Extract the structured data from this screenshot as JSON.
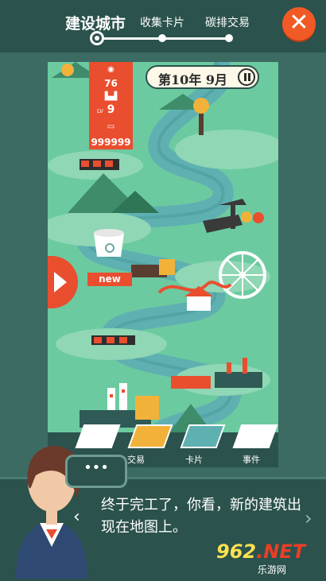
{
  "header": {
    "tabs": [
      {
        "label": "建设城市",
        "active": true
      },
      {
        "label": "收集卡片",
        "active": false
      },
      {
        "label": "碳排交易",
        "active": false
      }
    ],
    "close_icon": "close-icon"
  },
  "stats": {
    "satisfaction": "76",
    "level_label": "LV",
    "level": "9",
    "money": "999999"
  },
  "date": {
    "label": "第10年 9月"
  },
  "map": {
    "new_badge": "new"
  },
  "bottom_menu": {
    "items": [
      {
        "label": "交易"
      },
      {
        "label": "卡片"
      },
      {
        "label": "事件"
      }
    ]
  },
  "dialog": {
    "text": "终于完工了，你看，新的建筑出现在地图上。",
    "bubble": "•••"
  },
  "watermark": {
    "main_prefix": "962",
    "main_suffix": ".NET",
    "sub": "乐游网"
  },
  "colors": {
    "accent": "#e94e2f",
    "panel": "#2b524c",
    "map_green": "#6ccaa0",
    "river": "#5fb0b1"
  }
}
